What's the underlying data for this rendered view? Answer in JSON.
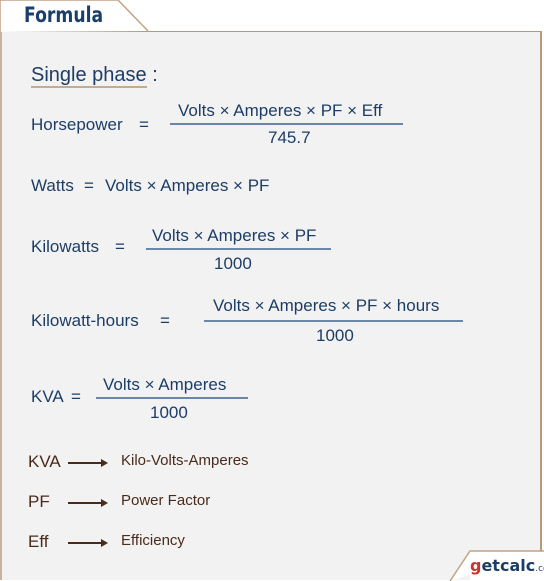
{
  "header": {
    "title": "Formula"
  },
  "section": {
    "heading": "Single phase",
    "heading_suffix": ":"
  },
  "formulas": [
    {
      "lhs": "Horsepower",
      "eq": "=",
      "numerator": "Volts × Amperes × PF × Eff",
      "denominator": "745.7"
    },
    {
      "lhs": "Watts",
      "eq": "=",
      "expression": "Volts × Amperes × PF"
    },
    {
      "lhs": "Kilowatts",
      "eq": "=",
      "numerator": "Volts × Amperes × PF",
      "denominator": "1000"
    },
    {
      "lhs": "Kilowatt-hours",
      "eq": "=",
      "numerator": "Volts × Amperes × PF × hours",
      "denominator": "1000"
    },
    {
      "lhs": "KVA",
      "eq": "=",
      "numerator": "Volts × Amperes",
      "denominator": "1000"
    }
  ],
  "legend": [
    {
      "term": "KVA",
      "definition": "Kilo-Volts-Amperes",
      "icon": "arrow-right-icon"
    },
    {
      "term": "PF",
      "definition": "Power Factor",
      "icon": "arrow-right-icon"
    },
    {
      "term": "Eff",
      "definition": "Efficiency",
      "icon": "arrow-right-icon"
    }
  ],
  "logo": {
    "g": "g",
    "brand": "etcalc",
    "tld": ".com"
  }
}
